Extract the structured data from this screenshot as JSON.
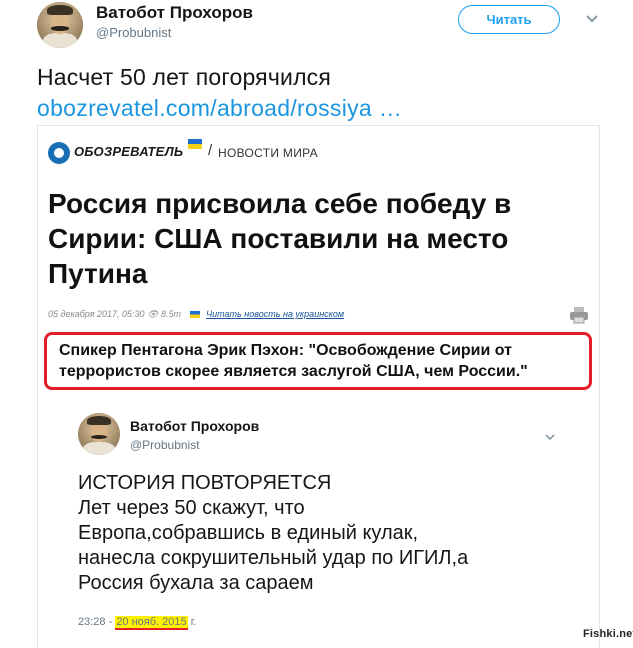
{
  "tweet": {
    "author_name": "Ватобот Прохоров",
    "author_handle": "@Probubnist",
    "follow_label": "Читать",
    "text": "Насчет 50 лет погорячился",
    "link": "obozrevatel.com/abroad/rossiya …",
    "more_icon": "chevron-down-icon"
  },
  "article": {
    "site_name": "ОБОЗРЕВАТЕЛЬ",
    "section": "НОВОСТИ МИРА",
    "separator": "/",
    "headline": "Россия присвоила себе победу в Сирии: США поставили на место Путина",
    "date": "05 декабря 2017, 05:30",
    "views": "8.5т",
    "ukr_link": "Читать новость на украинском",
    "quote": "Спикер Пентагона Эрик Пэхон: \"Освобождение Сирии от террористов скорее является заслугой США, чем России.\"",
    "quote_highlight_color": "#e41e26"
  },
  "quoted_tweet": {
    "author_name": "Ватобот Прохоров",
    "author_handle": "@Probubnist",
    "lines": [
      "ИСТОРИЯ ПОВТОРЯЕТСЯ",
      "Лет через 50 скажут, что",
      "Европа,собравшись в единый кулак,",
      "нанесла сокрушительный удар по ИГИЛ,а",
      "Россия бухала за сараем"
    ],
    "time": "23:28 -",
    "date": "20 нояб. 2015",
    "date_suffix": "г.",
    "date_highlight_color": "#fff200"
  },
  "watermark": "Fishki.net",
  "colors": {
    "accent": "#1da1f2",
    "link": "#1b95e0",
    "text": "#14171a",
    "muted": "#657786"
  }
}
